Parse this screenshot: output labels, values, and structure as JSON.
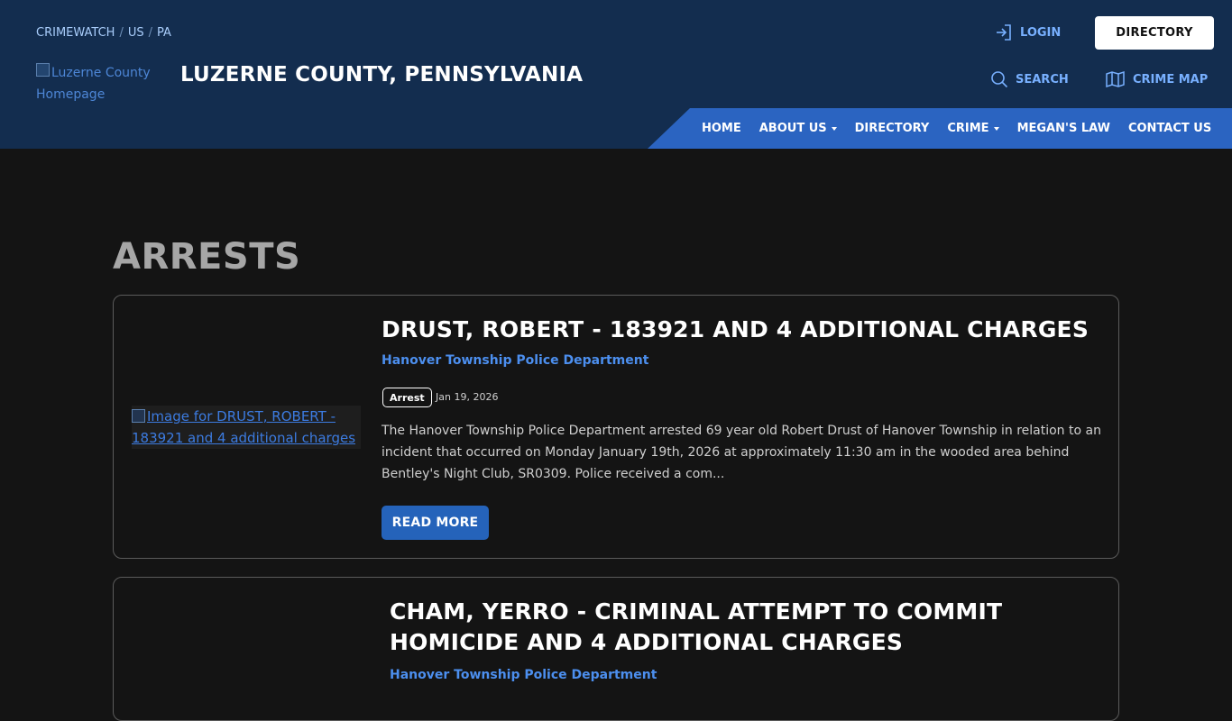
{
  "header": {
    "breadcrumb": [
      "CRIMEWATCH",
      "US",
      "PA"
    ],
    "breadcrumb_sep": "/",
    "logo_alt": "Luzerne County Homepage",
    "site_title": "LUZERNE COUNTY, PENNSYLVANIA",
    "login_label": "LOGIN",
    "directory_button": "DIRECTORY",
    "search_label": "SEARCH",
    "crime_map_label": "CRIME MAP"
  },
  "nav": {
    "items": [
      {
        "label": "HOME",
        "dropdown": false
      },
      {
        "label": "ABOUT US",
        "dropdown": true
      },
      {
        "label": "DIRECTORY",
        "dropdown": false
      },
      {
        "label": "CRIME",
        "dropdown": true
      },
      {
        "label": "MEGAN'S LAW",
        "dropdown": false
      },
      {
        "label": "CONTACT US",
        "dropdown": false
      }
    ]
  },
  "main": {
    "page_title": "ARRESTS",
    "cards": [
      {
        "image_alt": "Image for DRUST, ROBERT - 183921 and 4 additional charges",
        "title": "DRUST, ROBERT - 183921 AND 4 ADDITIONAL CHARGES",
        "department": "Hanover Township Police Department",
        "badge": "Arrest",
        "date": "Jan 19, 2026",
        "excerpt": "The Hanover Township Police Department arrested 69 year old Robert Drust of Hanover Township in relation to an incident that occurred on Monday January 19th, 2026 at approximately 11:30 am in the wooded area behind Bentley's Night Club, SR0309.  Police received a com...",
        "read_more": "READ MORE"
      },
      {
        "title": "CHAM, YERRO - CRIMINAL ATTEMPT TO COMMIT HOMICIDE AND 4 ADDITIONAL CHARGES",
        "department": "Hanover Township Police Department"
      }
    ]
  },
  "colors": {
    "header_bg": "#132d4f",
    "nav_bg": "#2b64c1",
    "page_bg": "#141414",
    "accent_link": "#4c8fef",
    "button": "#2563ba"
  },
  "icons": {
    "login": "login-arrow-icon",
    "search": "search-icon",
    "crime_map": "map-icon"
  }
}
